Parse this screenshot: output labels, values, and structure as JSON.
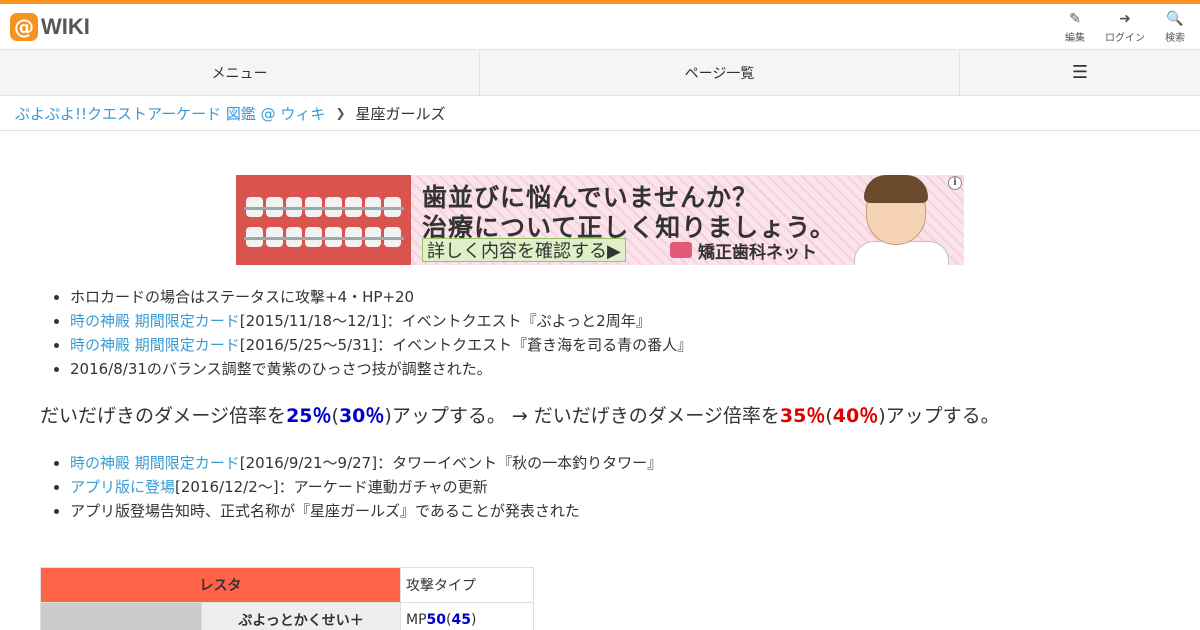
{
  "header": {
    "logo_mark": "@",
    "logo_text": "WIKI",
    "buttons": [
      {
        "icon": "pencil-icon",
        "glyph": "✎",
        "label": "編集"
      },
      {
        "icon": "sign-in-icon",
        "glyph": "➜",
        "label": "ログイン"
      },
      {
        "icon": "search-icon",
        "glyph": "🔍",
        "label": "検索"
      }
    ]
  },
  "nav": {
    "menu": "メニュー",
    "page_list": "ページ一覧",
    "hamburger_glyph": "☰"
  },
  "breadcrumb": {
    "site": "ぷよぷよ!!クエストアーケード 図鑑 @ ウィキ",
    "separator": "❯",
    "current": "星座ガールズ"
  },
  "ad": {
    "line1": "歯並びに悩んでいませんか？",
    "line2": "治療について正しく知りましょう。",
    "button": "詳しく内容を確認する▶",
    "brand": "矯正歯科ネット",
    "info": "i"
  },
  "list1": [
    {
      "text": "ホロカードの場合はステータスに攻撃+4・HP+20"
    },
    {
      "link": "時の神殿 期間限定カード",
      "text": "[2015/11/18～12/1]：イベントクエスト『ぷよっと2周年』"
    },
    {
      "link": "時の神殿 期間限定カード",
      "text": "[2016/5/25～5/31]：イベントクエスト『蒼き海を司る青の番人』"
    },
    {
      "text": "2016/8/31のバランス調整で黄紫のひっさつ技が調整された。"
    }
  ],
  "balance": {
    "prefix": "だいだげきのダメージ倍率を",
    "old_rate": "25％",
    "paren_open": "(",
    "old_rate_alt": "30％",
    "paren_close": ")",
    "mid": "アップする。 → だいだげきのダメージ倍率を",
    "new_rate": "35％",
    "new_rate_alt": "40％",
    "suffix": "アップする。"
  },
  "list2": [
    {
      "link": "時の神殿 期間限定カード",
      "text": "[2016/9/21～9/27]：タワーイベント『秋の一本釣りタワー』"
    },
    {
      "link": "アプリ版に登場",
      "text": "[2016/12/2～]：アーケード連動ガチャの更新"
    },
    {
      "text": "アプリ版登場告知時、正式名称が『星座ガールズ』であることが発表された"
    }
  ],
  "table": {
    "name": "レスタ",
    "type": "攻撃タイプ",
    "skill": "ぷよっとかくせい＋",
    "mp_label": "MP",
    "mp_value": "50",
    "mp_paren_open": "(",
    "mp_value_alt": "45",
    "mp_paren_close": ")"
  },
  "colors": {
    "accent": "#f7931e",
    "link": "#3a9bd2",
    "rate_blue": "#0000cc",
    "rate_red": "#e00000",
    "name_cell": "#ff6347"
  }
}
